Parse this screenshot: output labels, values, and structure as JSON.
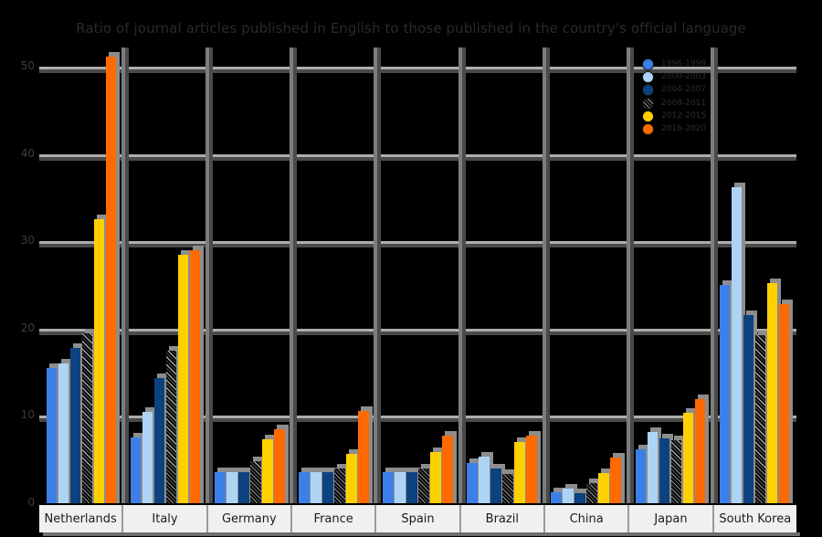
{
  "chart": {
    "title": "Ratio of journal articles published in English to those published in the country's official language"
  },
  "axis": {
    "y_ticks": [
      "50",
      "40",
      "30",
      "20",
      "10",
      "0"
    ],
    "y_label": "",
    "x_label": ""
  },
  "legend": {
    "position": "top-right",
    "items": [
      {
        "label": "1996-1999",
        "color": "#3d7fe8"
      },
      {
        "label": "2000-2003",
        "color": "#aed4f5"
      },
      {
        "label": "2004-2007",
        "color": "#0d4280"
      },
      {
        "label": "2008-2011",
        "color": "#111111"
      },
      {
        "label": "2012-2015",
        "color": "#ffd000"
      },
      {
        "label": "2016-2020",
        "color": "#ff6a00"
      }
    ]
  },
  "chart_data": {
    "type": "bar",
    "title": "Ratio of journal articles published in English to those published in the country's official language",
    "xlabel": "",
    "ylabel": "",
    "ylim": [
      0,
      52
    ],
    "grid": true,
    "legend_position": "top-right",
    "categories": [
      "Netherlands",
      "Italy",
      "Germany",
      "France",
      "Spain",
      "Brazil",
      "China",
      "Japan",
      "South Korea"
    ],
    "series": [
      {
        "name": "1996-1999",
        "color": "#3d7fe8",
        "values": [
          15.5,
          7.5,
          3.6,
          3.6,
          3.6,
          4.6,
          1.3,
          6.2,
          25.0
        ]
      },
      {
        "name": "2000-2003",
        "color": "#aed4f5",
        "values": [
          16.0,
          10.5,
          3.6,
          3.6,
          3.6,
          5.3,
          1.7,
          8.2,
          36.2
        ]
      },
      {
        "name": "2004-2007",
        "color": "#0d4280",
        "values": [
          17.8,
          14.3,
          3.6,
          3.6,
          3.6,
          4.0,
          1.2,
          7.4,
          21.5
        ]
      },
      {
        "name": "2008-2011",
        "color": "#111111",
        "values": [
          19.5,
          17.5,
          4.8,
          4.0,
          4.0,
          3.4,
          2.3,
          7.2,
          19.3
        ]
      },
      {
        "name": "2012-2015",
        "color": "#ffd000",
        "values": [
          32.5,
          28.5,
          7.3,
          5.7,
          5.9,
          7.0,
          3.5,
          10.4,
          25.2
        ]
      },
      {
        "name": "2016-2020",
        "color": "#ff6a00",
        "values": [
          51.2,
          29.0,
          8.5,
          10.6,
          7.7,
          7.7,
          5.2,
          11.9,
          22.8
        ]
      }
    ]
  }
}
